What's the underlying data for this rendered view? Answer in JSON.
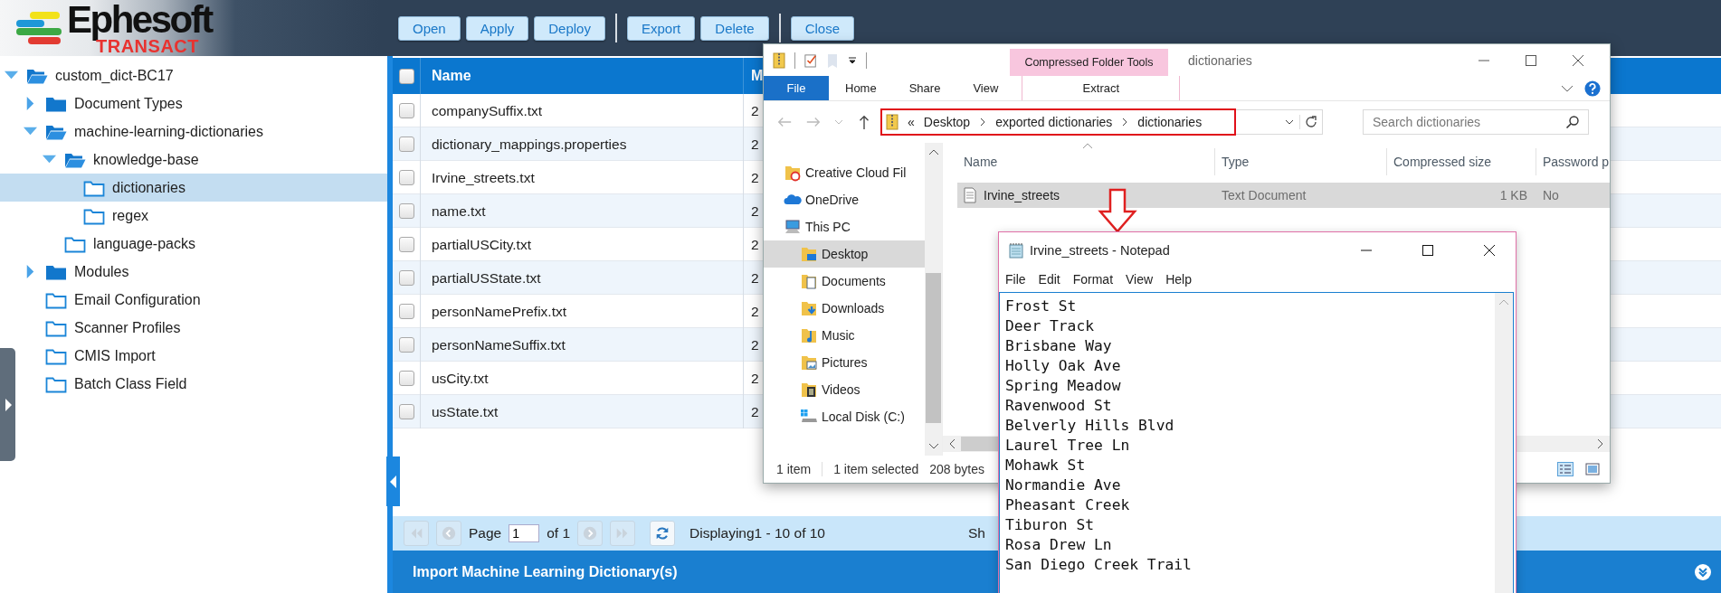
{
  "header": {
    "logo": {
      "wordmark": "Ephesoft",
      "product": "TRANSACT"
    },
    "toolbar_groups": [
      [
        {
          "label": "Open"
        },
        {
          "label": "Apply"
        },
        {
          "label": "Deploy"
        }
      ],
      [
        {
          "label": "Export"
        },
        {
          "label": "Delete"
        }
      ],
      [
        {
          "label": "Close"
        }
      ]
    ]
  },
  "tree": [
    {
      "label": "custom_dict-BC17",
      "kind": "branch",
      "expanded": true,
      "selected": false,
      "children": [
        {
          "label": "Document Types",
          "kind": "branch",
          "expanded": false,
          "selected": false
        },
        {
          "label": "machine-learning-dictionaries",
          "kind": "branch",
          "expanded": true,
          "selected": false,
          "children": [
            {
              "label": "knowledge-base",
              "kind": "branch",
              "expanded": true,
              "selected": false,
              "children": [
                {
                  "label": "dictionaries",
                  "kind": "leaf",
                  "selected": true
                },
                {
                  "label": "regex",
                  "kind": "leaf",
                  "selected": false
                }
              ]
            },
            {
              "label": "language-packs",
              "kind": "leaf",
              "selected": false
            }
          ]
        },
        {
          "label": "Modules",
          "kind": "branch",
          "expanded": false,
          "selected": false
        },
        {
          "label": "Email Configuration",
          "kind": "leaf",
          "selected": false
        },
        {
          "label": "Scanner Profiles",
          "kind": "leaf",
          "selected": false
        },
        {
          "label": "CMIS Import",
          "kind": "leaf",
          "selected": false
        },
        {
          "label": "Batch Class Field",
          "kind": "leaf",
          "selected": false
        }
      ]
    }
  ],
  "table": {
    "select_all": {
      "checked": false
    },
    "columns": [
      "Name",
      "M"
    ],
    "rows": [
      {
        "checked": false,
        "cells": [
          "companySuffix.txt",
          "2"
        ]
      },
      {
        "checked": false,
        "cells": [
          "dictionary_mappings.properties",
          "2"
        ]
      },
      {
        "checked": false,
        "cells": [
          "Irvine_streets.txt",
          "2"
        ]
      },
      {
        "checked": false,
        "cells": [
          "name.txt",
          "2"
        ]
      },
      {
        "checked": false,
        "cells": [
          "partialUSCity.txt",
          "2"
        ]
      },
      {
        "checked": false,
        "cells": [
          "partialUSState.txt",
          "2"
        ]
      },
      {
        "checked": false,
        "cells": [
          "personNamePrefix.txt",
          "2"
        ]
      },
      {
        "checked": false,
        "cells": [
          "personNameSuffix.txt",
          "2"
        ]
      },
      {
        "checked": false,
        "cells": [
          "usCity.txt",
          "2"
        ]
      },
      {
        "checked": false,
        "cells": [
          "usState.txt",
          "2"
        ]
      }
    ]
  },
  "pager": {
    "nav_before": [
      {
        "kind": "first",
        "disabled": true
      },
      {
        "kind": "prev",
        "disabled": true
      }
    ],
    "page_label": "Page",
    "page": "1",
    "of_label": "of 1",
    "nav_after": [
      {
        "kind": "next",
        "disabled": true
      },
      {
        "kind": "last",
        "disabled": true
      }
    ],
    "summary": "Displaying1 - 10 of 10",
    "column_3": "Sh"
  },
  "footer_panel": {
    "title": "Import Machine Learning Dictionary(s)"
  },
  "explorer": {
    "title": "dictionaries",
    "context_group": "Compressed Folder Tools",
    "ribbon_tabs": [
      {
        "label": "File",
        "kind": "file"
      },
      {
        "label": "Home",
        "kind": "plain"
      },
      {
        "label": "Share",
        "kind": "plain"
      },
      {
        "label": "View",
        "kind": "plain"
      },
      {
        "label": "Extract",
        "kind": "contextual"
      }
    ],
    "address": {
      "overflow": "«",
      "crumbs": [
        "Desktop",
        "exported dictionaries",
        "dictionaries"
      ],
      "highlighted": true
    },
    "search": {
      "placeholder": "Search dictionaries"
    },
    "nav": [
      {
        "label": "Creative Cloud Fil",
        "kind": "creative-cloud",
        "selected": false
      },
      {
        "label": "OneDrive",
        "kind": "cloud",
        "selected": false
      },
      {
        "label": "This PC",
        "kind": "pc",
        "selected": false,
        "children": [
          {
            "label": "Desktop",
            "kind": "desktop",
            "selected": true
          },
          {
            "label": "Documents",
            "kind": "documents",
            "selected": false
          },
          {
            "label": "Downloads",
            "kind": "downloads",
            "selected": false
          },
          {
            "label": "Music",
            "kind": "music",
            "selected": false
          },
          {
            "label": "Pictures",
            "kind": "pictures",
            "selected": false
          },
          {
            "label": "Videos",
            "kind": "videos",
            "selected": false
          },
          {
            "label": "Local Disk (C:)",
            "kind": "disk",
            "selected": false
          }
        ]
      }
    ],
    "columns": [
      "Name",
      "Type",
      "Compressed size",
      "Password p"
    ],
    "files": [
      {
        "cells": [
          "Irvine_streets",
          "Text Document",
          "1 KB",
          "No"
        ],
        "selected": true
      }
    ],
    "status": [
      "1 item",
      "1 item selected",
      "208 bytes"
    ]
  },
  "notepad": {
    "title": "Irvine_streets - Notepad",
    "menu": [
      "File",
      "Edit",
      "Format",
      "View",
      "Help"
    ],
    "lines": [
      "Frost St",
      "Deer Track",
      "Brisbane Way",
      "Holly Oak Ave",
      "Spring Meadow",
      "Ravenwood St",
      "Belverly Hills Blvd",
      "Laurel Tree Ln",
      "Mohawk St",
      "Normandie Ave",
      "Pheasant Creek",
      "Tiburon St",
      "Rosa Drew Ln",
      "San Diego Creek Trail"
    ]
  }
}
